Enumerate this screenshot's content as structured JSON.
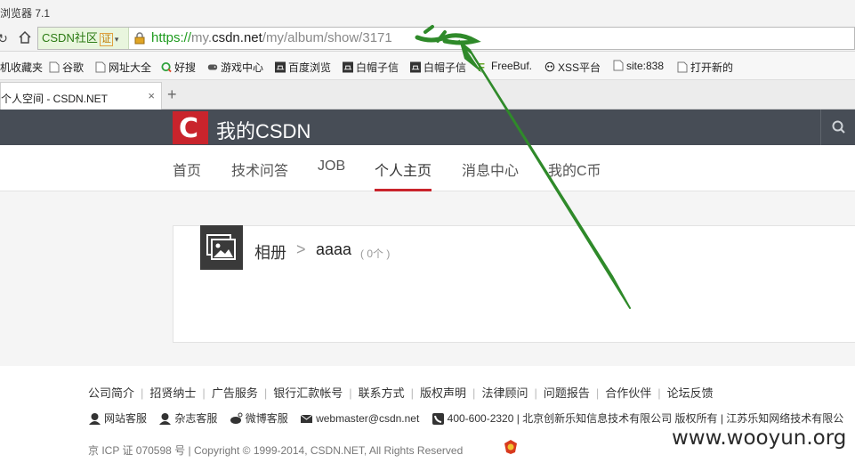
{
  "browser": {
    "title": "浏览器 7.1",
    "site_badge": "CSDN社区",
    "cert_label": "证",
    "url_scheme": "https://",
    "url_sub": "my.",
    "url_host": "csdn.net",
    "url_path": "/my/album/show/3171",
    "tab_title": "个人空间 - CSDN.NET",
    "tab_close": "×",
    "new_tab": "+"
  },
  "bookmarks": [
    {
      "label": "机收藏夹",
      "icon": "folder-icon"
    },
    {
      "label": "谷歌",
      "icon": "page-icon"
    },
    {
      "label": "网址大全",
      "icon": "page-icon"
    },
    {
      "label": "好搜",
      "icon": "search-logo-icon"
    },
    {
      "label": "游戏中心",
      "icon": "gamepad-icon"
    },
    {
      "label": "百度浏览",
      "icon": "hat-icon"
    },
    {
      "label": "白帽子信",
      "icon": "hat-icon"
    },
    {
      "label": "白帽子信",
      "icon": "hat-icon"
    },
    {
      "label": "FreeBuf.",
      "icon": "freebuf-icon"
    },
    {
      "label": "XSS平台",
      "icon": "skull-icon"
    },
    {
      "label": "site:838",
      "icon": "page-icon"
    },
    {
      "label": "打开新的",
      "icon": "page-icon"
    }
  ],
  "csdn": {
    "logo_letter": "C",
    "brand": "我的CSDN",
    "nav": [
      "首页",
      "技术问答",
      "JOB",
      "个人主页",
      "消息中心",
      "我的C币"
    ],
    "active_nav": "个人主页",
    "breadcrumb_root": "相册",
    "breadcrumb_sep": ">",
    "album_name": "aaaa",
    "album_count": "( 0个 )"
  },
  "footer": {
    "links": [
      "公司简介",
      "招贤纳士",
      "广告服务",
      "银行汇款帐号",
      "联系方式",
      "版权声明",
      "法律顾问",
      "问题报告",
      "合作伙伴",
      "论坛反馈"
    ],
    "contact_site": "网站客服",
    "contact_mag": "杂志客服",
    "contact_weibo": "微博客服",
    "contact_email": "webmaster@csdn.net",
    "contact_phone": "400-600-2320",
    "contact_rest": "| 北京创新乐知信息技术有限公司 版权所有 | 江苏乐知网络技术有限公",
    "icp": "京 ICP 证 070598 号 | Copyright © 1999-2014, CSDN.NET, All Rights Reserved"
  },
  "watermark": "www.wooyun.org",
  "colors": {
    "csdn_red": "#c9242c",
    "top_bar": "#474d56",
    "annotation_green": "#2f8a2a"
  }
}
